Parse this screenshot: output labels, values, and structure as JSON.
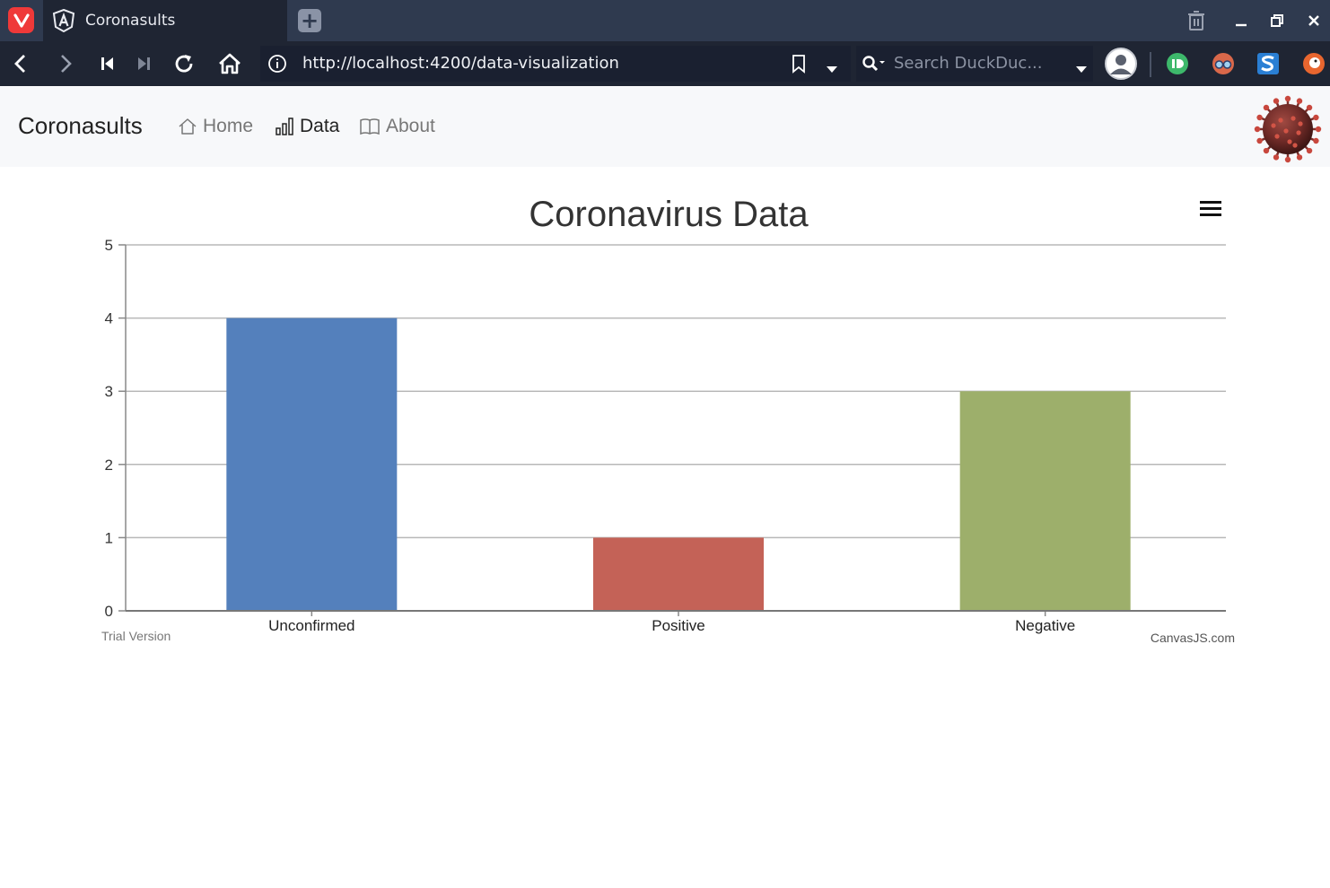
{
  "browser": {
    "tab_title": "Coronasults",
    "url": "http://localhost:4200/data-visualization",
    "search_placeholder": "Search DuckDuc..."
  },
  "app": {
    "brand": "Coronasults",
    "nav": [
      {
        "label": "Home",
        "icon": "home-icon",
        "active": false
      },
      {
        "label": "Data",
        "icon": "bar-chart-icon",
        "active": true
      },
      {
        "label": "About",
        "icon": "book-icon",
        "active": false
      }
    ]
  },
  "chart_data": {
    "type": "bar",
    "title": "Coronavirus Data",
    "categories": [
      "Unconfirmed",
      "Positive",
      "Negative"
    ],
    "values": [
      4,
      1,
      3
    ],
    "colors": [
      "#5480bc",
      "#c46257",
      "#9daf6b"
    ],
    "ylim": [
      0,
      5
    ],
    "yticks": [
      0,
      1,
      2,
      3,
      4,
      5
    ],
    "grid": true,
    "watermark_left": "Trial Version",
    "watermark_right": "CanvasJS.com"
  }
}
